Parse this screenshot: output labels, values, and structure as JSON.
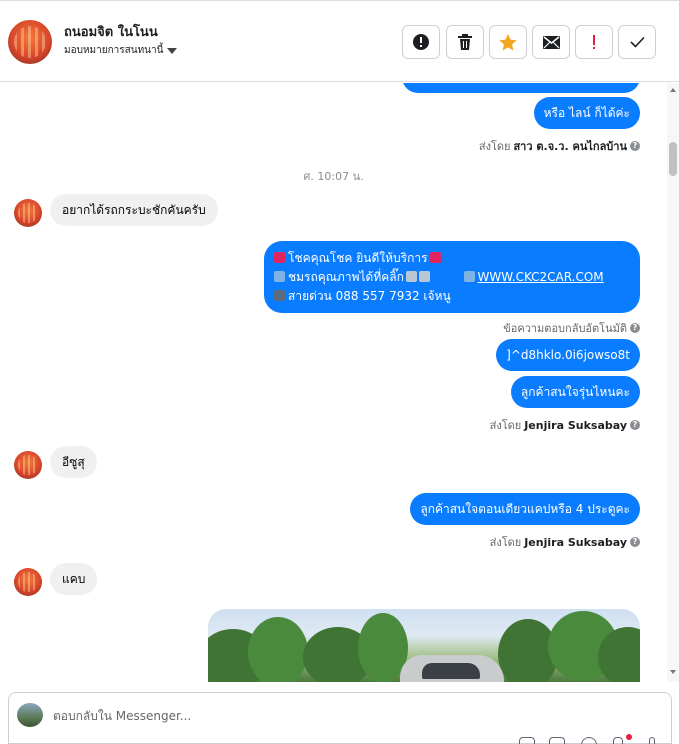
{
  "header": {
    "contact_name": "ถนอมจิต ในโนน",
    "assign_label": "มอบหมายการสนทนานี้",
    "actions": [
      {
        "name": "report-button",
        "icon": "alert-circle-icon",
        "glyph": "!"
      },
      {
        "name": "delete-button",
        "icon": "trash-icon",
        "glyph": ""
      },
      {
        "name": "star-button",
        "icon": "star-icon",
        "glyph": "★"
      },
      {
        "name": "mark-unread-button",
        "icon": "envelope-icon",
        "glyph": ""
      },
      {
        "name": "spam-button",
        "icon": "exclamation-icon",
        "glyph": "!"
      },
      {
        "name": "done-button",
        "icon": "check-icon",
        "glyph": "✓"
      }
    ]
  },
  "thread": {
    "outgoing_reply_line": "หรือ ไลน์ ก็ได้ค่ะ",
    "sent_by_prefix": "ส่งโดย",
    "sent_by_agent1": "สาว ต.จ.ว. คนไกลบ้าน",
    "timestamp": "ศ. 10:07 น.",
    "incoming_1": "อยากได้รถกระบะชักคันครับ",
    "auto_reply": {
      "line1": "โชคคุณโชค ยินดีให้บริการ",
      "line2": "ชมรถคุณภาพได้ที่คลิ๊ก",
      "link": "WWW.CKC2CAR.COM",
      "line3": "สายด่วน 088 557 7932 เจ้หนู"
    },
    "auto_reply_label": "ข้อความตอบกลับอัตโนมัติ",
    "outgoing_code": "]^d8hklo.0i6jowso8t",
    "outgoing_question": "ลูกค้าสนใจรุ่นไหนคะ",
    "sent_by_agent2": "Jenjira Suksabay",
    "incoming_2": "อีซูสุ",
    "outgoing_cab": "ลูกค้าสนใจตอนเดียวแคปหรือ 4 ประตูคะ",
    "incoming_3": "แคบ"
  },
  "composer": {
    "placeholder": "ตอบกลับใน Messenger..."
  },
  "colors": {
    "bubble_out": "#0a7cff",
    "bubble_in": "#f0f0f0",
    "star": "#f5a623",
    "spam": "#e41e3f"
  }
}
